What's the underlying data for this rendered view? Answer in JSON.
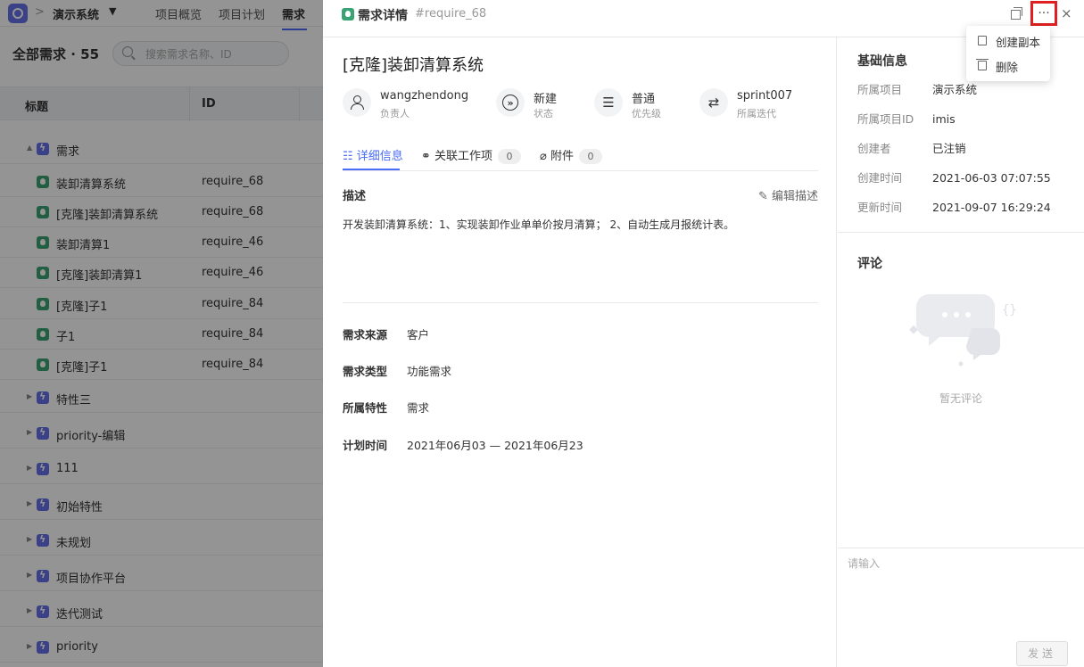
{
  "background": {
    "project_name": "演示系统",
    "breadcrumb_sep": ">",
    "nav_tabs": [
      "项目概览",
      "项目计划",
      "需求"
    ],
    "list_title": "全部需求 · 55",
    "search_placeholder": "搜索需求名称、ID",
    "columns": [
      "标题",
      "ID"
    ],
    "rows": [
      {
        "kind": "feature",
        "expanded": true,
        "label": "需求",
        "id": ""
      },
      {
        "kind": "requirement",
        "label": "装卸清算系统",
        "id": "require_68"
      },
      {
        "kind": "requirement",
        "label": "[克隆]装卸清算系统",
        "id": "require_68"
      },
      {
        "kind": "requirement",
        "label": "装卸清算1",
        "id": "require_46"
      },
      {
        "kind": "requirement",
        "label": "[克隆]装卸清算1",
        "id": "require_46"
      },
      {
        "kind": "requirement",
        "label": "[克隆]子1",
        "id": "require_84"
      },
      {
        "kind": "requirement",
        "label": "子1",
        "id": "require_84"
      },
      {
        "kind": "requirement",
        "label": "[克隆]子1",
        "id": "require_84"
      },
      {
        "kind": "feature",
        "label": "特性三",
        "id": ""
      },
      {
        "kind": "feature",
        "label": "priority-编辑",
        "id": ""
      },
      {
        "kind": "feature",
        "label": "111",
        "id": ""
      },
      {
        "kind": "feature",
        "label": "初始特性",
        "id": ""
      },
      {
        "kind": "feature",
        "label": "未规划",
        "id": ""
      },
      {
        "kind": "feature",
        "label": "项目协作平台",
        "id": ""
      },
      {
        "kind": "feature",
        "label": "迭代测试",
        "id": ""
      },
      {
        "kind": "feature",
        "label": "priority",
        "id": ""
      }
    ]
  },
  "drawer": {
    "header_title": "需求详情",
    "header_id": "#require_68",
    "more_label": "···",
    "close_label": "×",
    "title": "[克隆]装卸清算系统",
    "meta": [
      {
        "value": "wangzhendong",
        "label": "负责人"
      },
      {
        "value": "新建",
        "label": "状态"
      },
      {
        "value": "普通",
        "label": "优先级"
      },
      {
        "value": "sprint007",
        "label": "所属迭代"
      }
    ],
    "tabs": [
      {
        "label": "详细信息"
      },
      {
        "label": "关联工作项",
        "count": "0"
      },
      {
        "label": "附件",
        "count": "0"
      }
    ],
    "desc_title": "描述",
    "edit_desc": "编辑描述",
    "desc_text": "开发装卸清算系统：1、实现装卸作业单单价按月清算； 2、自动生成月报统计表。",
    "fields": [
      {
        "label": "需求来源",
        "value": "客户"
      },
      {
        "label": "需求类型",
        "value": "功能需求"
      },
      {
        "label": "所属特性",
        "value": "需求"
      },
      {
        "label": "计划时间",
        "value": "2021年06月03 — 2021年06月23"
      }
    ],
    "basic_info_title": "基础信息",
    "basic_info": [
      {
        "label": "所属项目",
        "value": "演示系统"
      },
      {
        "label": "所属项目ID",
        "value": "imis"
      },
      {
        "label": "创建者",
        "value": "已注销"
      },
      {
        "label": "创建时间",
        "value": "2021-06-03 07:07:55"
      },
      {
        "label": "更新时间",
        "value": "2021-09-07 16:29:24"
      }
    ],
    "comment_title": "评论",
    "empty_comment": "暂无评论",
    "comment_placeholder": "请输入",
    "send_label": "发送"
  },
  "menu": {
    "items": [
      "创建副本",
      "删除"
    ]
  },
  "colors": {
    "accent": "#4a6cf7",
    "requirement_icon": "#3aa373",
    "feature_icon": "#6470e8",
    "highlight_border": "#e02020"
  }
}
